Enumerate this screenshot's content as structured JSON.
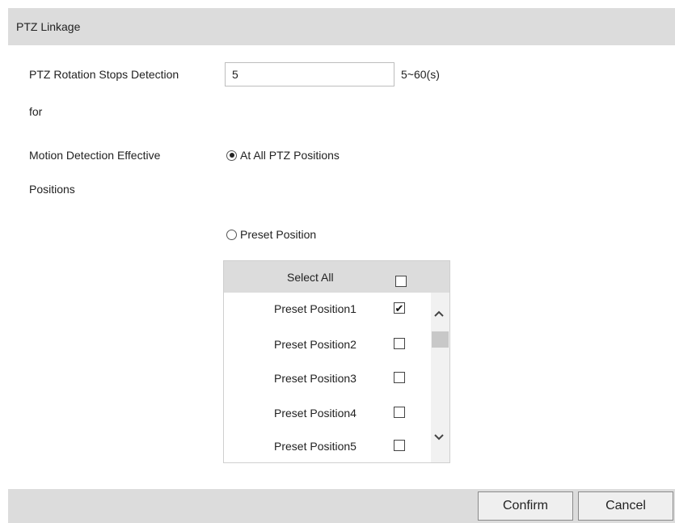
{
  "header": {
    "title": "PTZ Linkage"
  },
  "rotation_stop": {
    "label_line1": "PTZ Rotation Stops Detection",
    "label_line2": "for",
    "value": "5",
    "range": "5~60(s)"
  },
  "motion_positions": {
    "label_line1": "Motion Detection Effective",
    "label_line2": "Positions",
    "options": [
      {
        "label": "At All PTZ Positions",
        "selected": true
      },
      {
        "label": "Preset Position",
        "selected": false
      }
    ]
  },
  "preset_list": {
    "select_all_label": "Select All",
    "select_all_checked": false,
    "items": [
      {
        "label": "Preset Position1",
        "checked": true
      },
      {
        "label": "Preset Position2",
        "checked": false
      },
      {
        "label": "Preset Position3",
        "checked": false
      },
      {
        "label": "Preset Position4",
        "checked": false
      },
      {
        "label": "Preset Position5",
        "checked": false
      }
    ]
  },
  "footer": {
    "confirm_label": "Confirm",
    "cancel_label": "Cancel"
  }
}
